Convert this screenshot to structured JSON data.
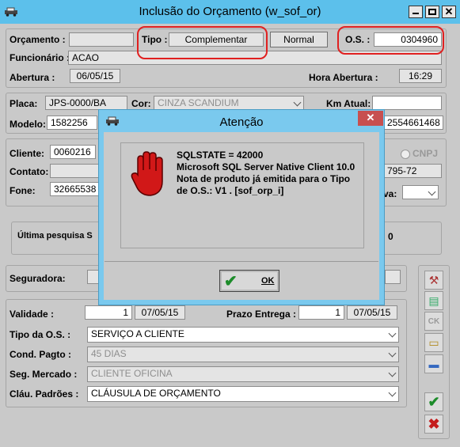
{
  "window": {
    "title": "Inclusão do Orçamento (w_sof_or)"
  },
  "header": {
    "orcamento_label": "Orçamento :",
    "tipo_label": "Tipo :",
    "tipo_value": "Complementar",
    "normal_label": "Normal",
    "os_label": "O.S. :",
    "os_value": "0304960",
    "funcionario_label": "Funcionário :",
    "funcionario_value": "ACAO",
    "abertura_label": "Abertura :",
    "abertura_value": "06/05/15",
    "hora_abertura_label": "Hora Abertura :",
    "hora_abertura_value": "16:29"
  },
  "vehicle": {
    "placa_label": "Placa:",
    "placa_value": "JPS-0000/BA",
    "cor_label": "Cor:",
    "cor_value": "CINZA SCANDIUM",
    "km_label": "Km Atual:",
    "km_value": "",
    "modelo_label": "Modelo:",
    "modelo_value": "1582256",
    "chassi_partial": "2554661468"
  },
  "client": {
    "cliente_label": "Cliente:",
    "cliente_value": "0060216",
    "cnpj_label": "CNPJ",
    "contato_label": "Contato:",
    "doc_partial": "795-72",
    "fone_label": "Fone:",
    "fone_value": "32665538",
    "va_partial": "va:"
  },
  "ultima": {
    "label": "Última pesquisa S",
    "right_partial": "0"
  },
  "seguradora": {
    "label": "Seguradora:"
  },
  "terms": {
    "validade_label": "Validade :",
    "validade_days": "1",
    "validade_date": "07/05/15",
    "prazo_label": "Prazo Entrega :",
    "prazo_days": "1",
    "prazo_date": "07/05/15",
    "tipo_os_label": "Tipo da O.S. :",
    "tipo_os_value": "SERVIÇO A CLIENTE",
    "cond_label": "Cond. Pagto :",
    "cond_value": "45 DIAS",
    "seg_label": "Seg. Mercado :",
    "seg_value": "CLIENTE OFICINA",
    "claus_label": "Cláu. Padrões :",
    "claus_value": "CLÁUSULA DE ORÇAMENTO"
  },
  "dialog": {
    "title": "Atenção",
    "line1": "SQLSTATE = 42000",
    "line2": "Microsoft SQL Server Native Client 10.0",
    "line3": "Nota de produto já emitida para o Tipo",
    "line4": "de O.S.: V1 . [sof_orp_i]",
    "ok_label": "OK"
  },
  "toolbar": {
    "ck_label": "CK"
  },
  "colors": {
    "titlebar": "#5cc0eb",
    "dialog_title": "#7ac9ee",
    "highlight": "#e02020",
    "close": "#c75050"
  }
}
